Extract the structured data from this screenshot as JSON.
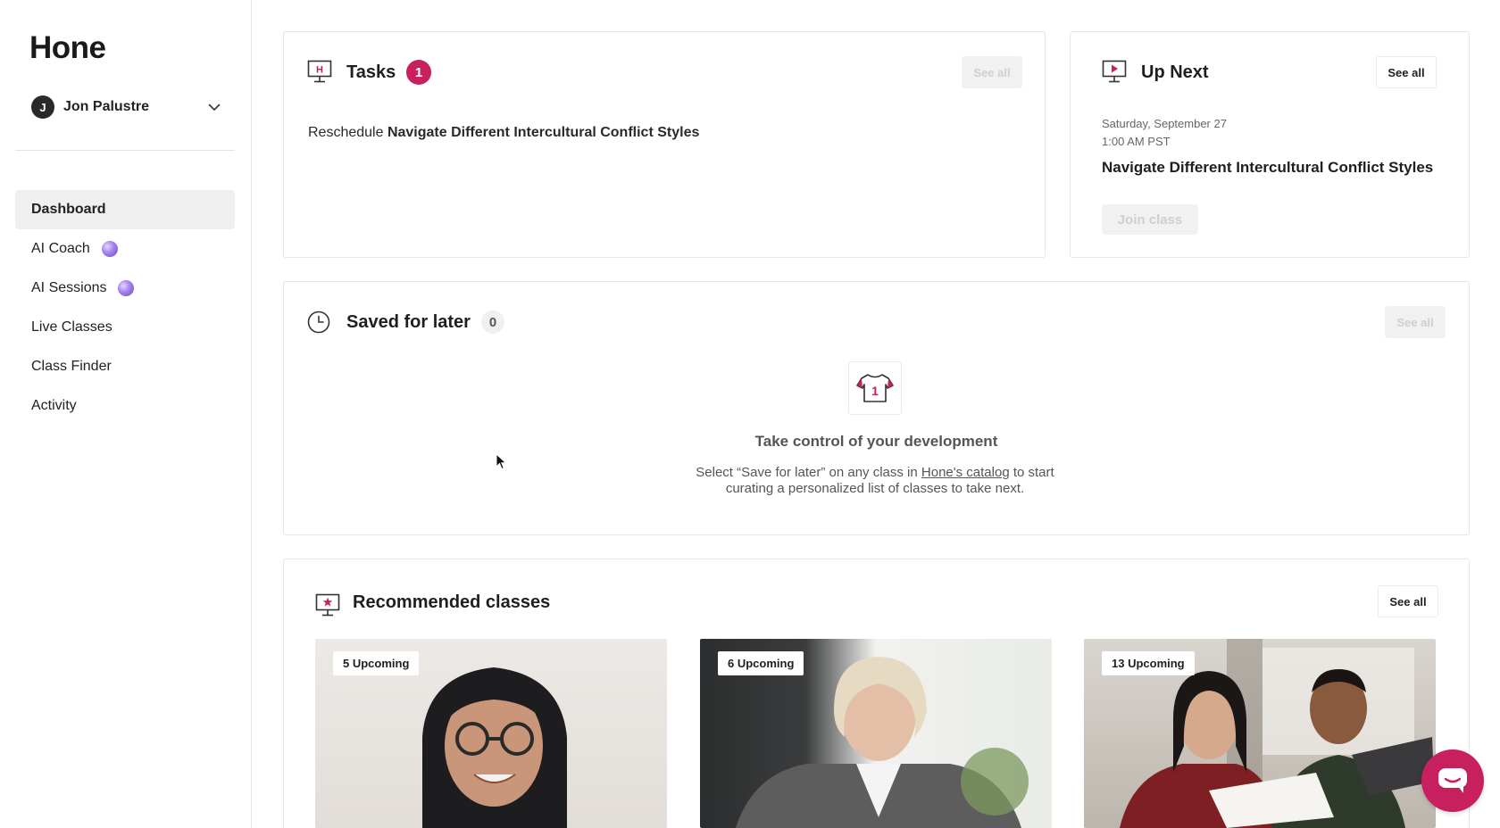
{
  "app": {
    "logo": "Hone"
  },
  "user": {
    "initial": "J",
    "name": "Jon Palustre"
  },
  "nav": [
    {
      "label": "Dashboard",
      "active": true
    },
    {
      "label": "AI Coach",
      "orb": true
    },
    {
      "label": "AI Sessions",
      "orb": true
    },
    {
      "label": "Live Classes"
    },
    {
      "label": "Class Finder"
    },
    {
      "label": "Activity"
    }
  ],
  "tasks": {
    "title": "Tasks",
    "count": "1",
    "see_all": "See all",
    "item_prefix": "Reschedule",
    "item_title": "Navigate Different Intercultural Conflict Styles"
  },
  "up_next": {
    "title": "Up Next",
    "see_all": "See all",
    "date": "Saturday, September 27",
    "time": "1:00 AM PST",
    "class_title": "Navigate Different Intercultural Conflict Styles",
    "join_label": "Join class"
  },
  "saved": {
    "title": "Saved for later",
    "count": "0",
    "see_all": "See all",
    "empty_icon_number": "1",
    "empty_title": "Take control of your development",
    "empty_text_before": "Select “Save for later” on any class in ",
    "empty_link": "Hone's catalog",
    "empty_text_after": " to start curating a personalized list of classes to take next."
  },
  "recommended": {
    "title": "Recommended classes",
    "see_all": "See all",
    "classes": [
      {
        "upcoming": "5 Upcoming"
      },
      {
        "upcoming": "6 Upcoming"
      },
      {
        "upcoming": "13 Upcoming"
      }
    ]
  },
  "colors": {
    "accent": "#c8205e",
    "active_nav_bg": "#efefef",
    "border": "#e6e6e6",
    "disabled_text": "#cfcfcf"
  }
}
